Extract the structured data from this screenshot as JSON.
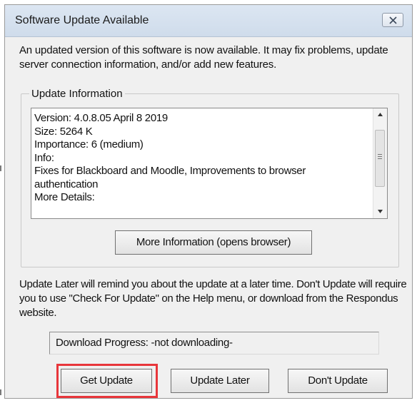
{
  "dialog": {
    "title": "Software Update Available",
    "close_icon": "close-x-icon",
    "intro_text": "An updated version of this software is now available.  It may fix problems, update server connection information, and/or add new features."
  },
  "update_info": {
    "group_label": "Update Information",
    "lines": [
      "Version: 4.0.8.05 April 8 2019",
      "Size: 5264 K",
      "Importance: 6 (medium)",
      "Info:",
      "Fixes for Blackboard and Moodle, Improvements to browser",
      "authentication",
      "More Details:"
    ],
    "more_info_label": "More Information (opens browser)"
  },
  "later_text": "Update Later will remind you about the update at a later time.  Don't Update will require you to use \"Check For Update\" on the Help menu, or download from the Respondus website.",
  "progress": {
    "text": "Download Progress:  -not downloading-"
  },
  "buttons": {
    "get_update": "Get Update",
    "update_later": "Update Later",
    "dont_update": "Don't Update"
  },
  "colors": {
    "highlight": "#e8363b",
    "dialog_bg": "#f0f0f0",
    "titlebar": "#d7e2ef"
  }
}
